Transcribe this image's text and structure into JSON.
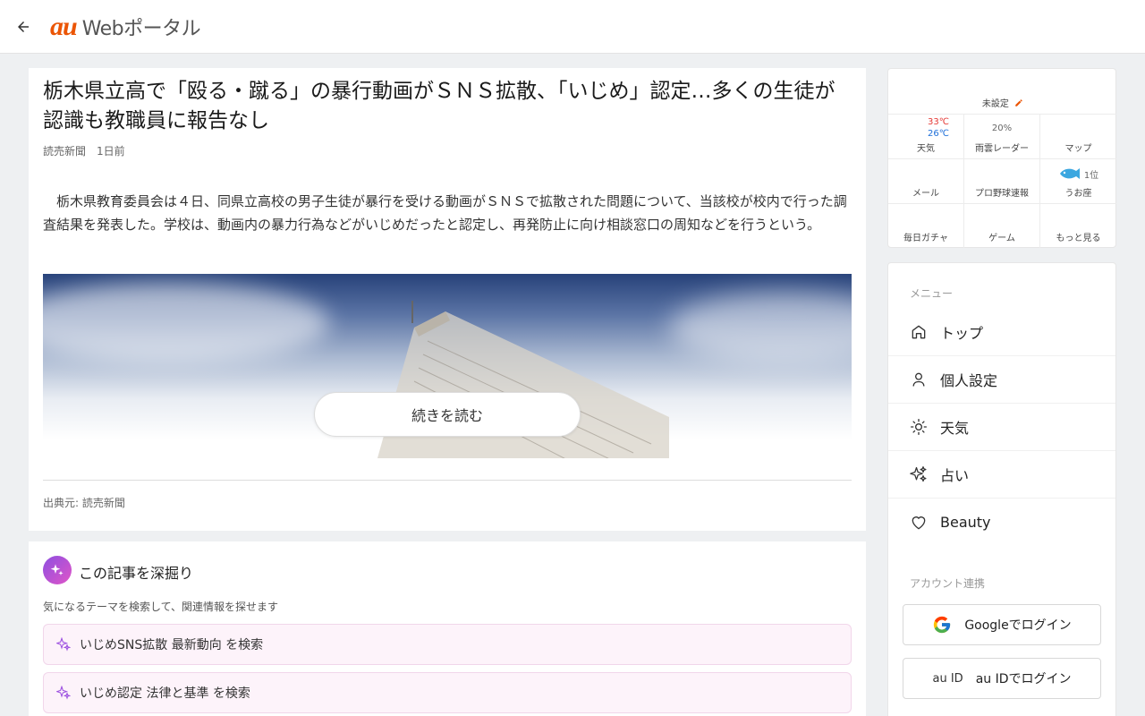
{
  "header": {
    "logo_brand": "au",
    "logo_text": "Webポータル"
  },
  "article": {
    "title": "栃木県立高で「殴る・蹴る」の暴行動画がＳＮＳ拡散、「いじめ」認定…多くの生徒が認識も教職員に報告なし",
    "publisher": "読売新聞",
    "time": "1日前",
    "lead": "栃木県教育委員会は４日、同県立高校の男子生徒が暴行を受ける動画がＳＮＳで拡散された問題について、当該校が校内で行った調査結果を発表した。学校は、動画内の暴力行為などがいじめだったと認定し、再発防止に向け相談窓口の周知などを行うという。",
    "read_more": "続きを読む",
    "source": "出典元: 読売新聞"
  },
  "deepdive": {
    "title": "この記事を深掘り",
    "description": "気になるテーマを検索して、関連情報を探せます",
    "chips": [
      {
        "label": "いじめSNS拡散 最新動向 を検索"
      },
      {
        "label": "いじめ認定 法律と基準 を検索"
      }
    ]
  },
  "widget": {
    "location": "未設定",
    "weather": {
      "label": "天気",
      "high": "33℃",
      "low": "26℃"
    },
    "rain": {
      "label": "雨雲レーダー",
      "value": "20%"
    },
    "map": {
      "label": "マップ"
    },
    "mail": {
      "label": "メール"
    },
    "baseball": {
      "label": "プロ野球速報"
    },
    "horoscope": {
      "label": "うお座",
      "rank": "1位"
    },
    "gacha": {
      "label": "毎日ガチャ"
    },
    "game": {
      "label": "ゲーム"
    },
    "more": {
      "label": "もっと見る"
    },
    "colors": {
      "high": "#e53935",
      "low": "#1e6fd9",
      "accent": "#eb5505"
    }
  },
  "menu": {
    "section_menu": "メニュー",
    "items": [
      {
        "label": "トップ",
        "icon": "home-icon"
      },
      {
        "label": "個人設定",
        "icon": "person-icon"
      },
      {
        "label": "天気",
        "icon": "sun-icon"
      },
      {
        "label": "占い",
        "icon": "sparkle-icon"
      },
      {
        "label": "Beauty",
        "icon": "heart-icon"
      }
    ],
    "section_account": "アカウント連携",
    "google_login": "Googleでログイン",
    "auid_login": "au IDでログイン",
    "auid_img_alt": "au ID"
  }
}
